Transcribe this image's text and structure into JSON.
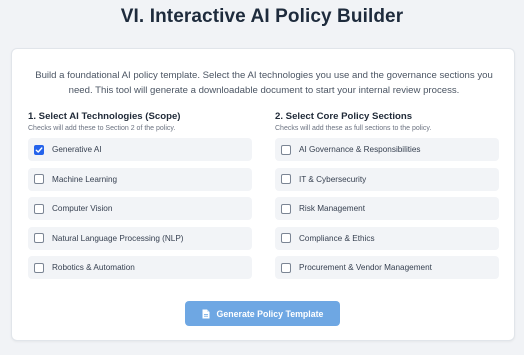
{
  "page": {
    "title": "VI. Interactive AI Policy Builder",
    "intro": "Build a foundational AI policy template. Select the AI technologies you use and the governance sections you need. This tool will generate a downloadable document to start your internal review process."
  },
  "technologies": {
    "heading": "1. Select AI Technologies (Scope)",
    "hint": "Checks will add these to Section 2 of the policy.",
    "options": [
      {
        "label": "Generative AI",
        "checked": true
      },
      {
        "label": "Machine Learning",
        "checked": false
      },
      {
        "label": "Computer Vision",
        "checked": false
      },
      {
        "label": "Natural Language Processing (NLP)",
        "checked": false
      },
      {
        "label": "Robotics & Automation",
        "checked": false
      }
    ]
  },
  "sections": {
    "heading": "2. Select Core Policy Sections",
    "hint": "Checks will add these as full sections to the policy.",
    "options": [
      {
        "label": "AI Governance & Responsibilities",
        "checked": false
      },
      {
        "label": "IT & Cybersecurity",
        "checked": false
      },
      {
        "label": "Risk Management",
        "checked": false
      },
      {
        "label": "Compliance & Ethics",
        "checked": false
      },
      {
        "label": "Procurement & Vendor Management",
        "checked": false
      }
    ]
  },
  "generate_button": {
    "label": "Generate Policy Template",
    "icon": "document-icon"
  },
  "colors": {
    "accent": "#2563eb",
    "button": "#6ea7e3",
    "option_bg": "#f2f4f7"
  }
}
